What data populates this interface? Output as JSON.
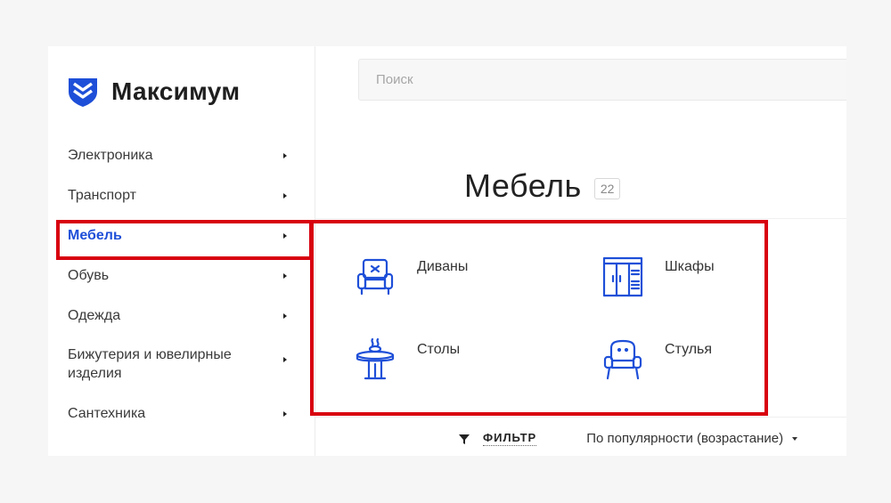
{
  "brand": {
    "name": "Максимум",
    "logo_icon": "shield-chevron-logo",
    "accent_color": "#1e4fd8"
  },
  "search": {
    "placeholder": "Поиск"
  },
  "sidebar": {
    "items": [
      {
        "label": "Электроника",
        "active": false
      },
      {
        "label": "Транспорт",
        "active": false
      },
      {
        "label": "Мебель",
        "active": true
      },
      {
        "label": "Обувь",
        "active": false
      },
      {
        "label": "Одежда",
        "active": false
      },
      {
        "label": "Бижутерия и ювелирные изделия",
        "active": false
      },
      {
        "label": "Сантехника",
        "active": false
      }
    ]
  },
  "page": {
    "title": "Мебель",
    "count": "22"
  },
  "categories": [
    {
      "label": "Диваны",
      "icon": "armchair-sofa-icon"
    },
    {
      "label": "Шкафы",
      "icon": "wardrobe-icon"
    },
    {
      "label": "Столы",
      "icon": "table-icon"
    },
    {
      "label": "Стулья",
      "icon": "chair-icon"
    }
  ],
  "toolbar": {
    "filter_label": "ФИЛЬТР",
    "sort_label": "По популярности (возрастание)"
  },
  "highlight_color": "#d8000f"
}
